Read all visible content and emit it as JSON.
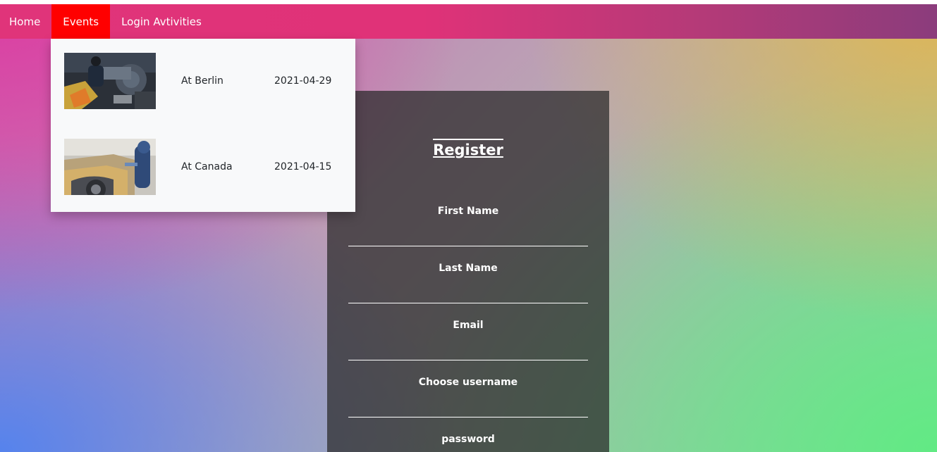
{
  "nav": {
    "items": [
      {
        "label": "Home"
      },
      {
        "label": "Events"
      },
      {
        "label": "Login Avtivities"
      }
    ],
    "active_color": "#ff0000"
  },
  "events_dropdown": {
    "items": [
      {
        "image": "car-engine-repair-photo",
        "place": "At Berlin",
        "date": "2021-04-29"
      },
      {
        "image": "car-painting-photo",
        "place": "At Canada",
        "date": "2021-04-15"
      }
    ]
  },
  "register": {
    "title": "Register",
    "fields": [
      {
        "label": "First Name",
        "value": ""
      },
      {
        "label": "Last Name",
        "value": ""
      },
      {
        "label": "Email",
        "value": ""
      },
      {
        "label": "Choose username",
        "value": ""
      },
      {
        "label": "password",
        "value": ""
      }
    ]
  }
}
